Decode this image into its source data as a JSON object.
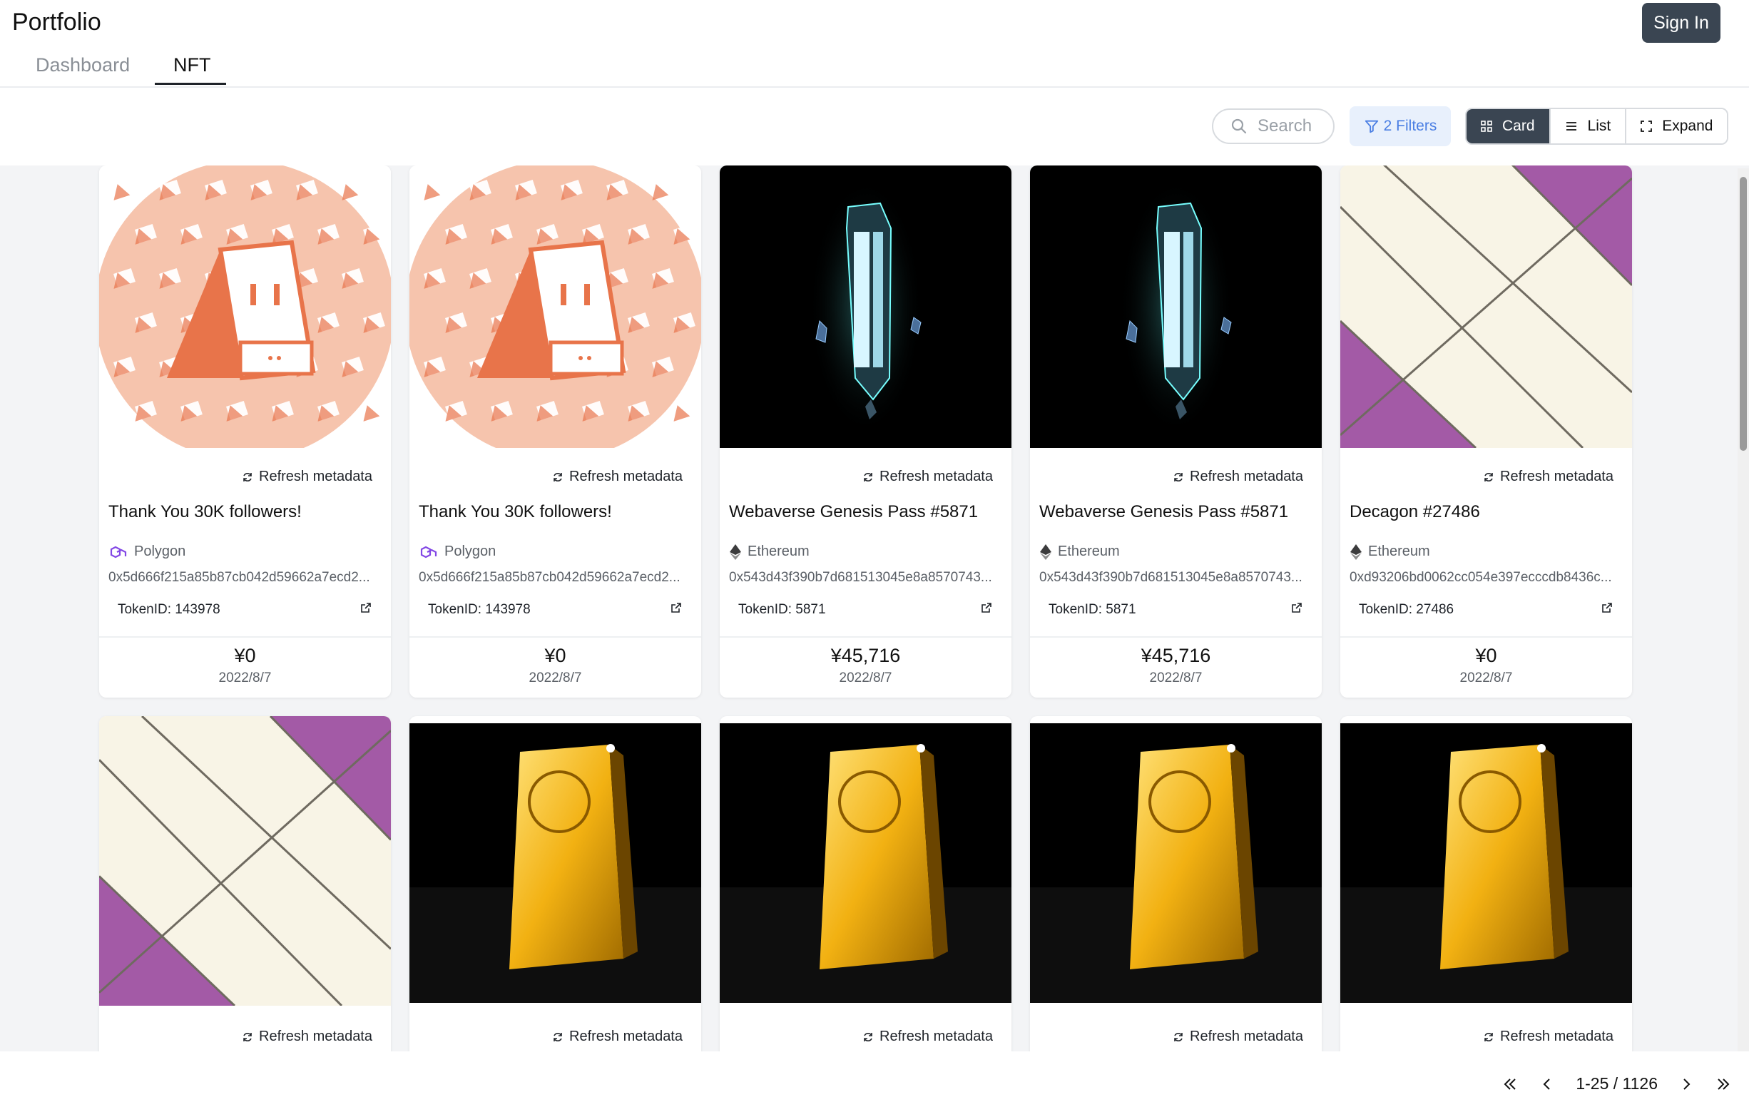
{
  "header": {
    "title": "Portfolio",
    "signin_label": "Sign In",
    "tabs": [
      "Dashboard",
      "NFT"
    ],
    "active_tab": "NFT"
  },
  "toolbar": {
    "search_placeholder": "Search",
    "filters_label": "2 Filters",
    "views": [
      "Card",
      "List",
      "Expand"
    ],
    "active_view": "Card"
  },
  "cards": [
    {
      "refresh": "Refresh metadata",
      "name": "Thank You 30K followers!",
      "chain": "Polygon",
      "address": "0x5d666f215a85b87cb042d59662a7ecd2...",
      "token": "TokenID: 143978",
      "price": "¥0",
      "date": "2022/8/7",
      "image": "kudasai"
    },
    {
      "refresh": "Refresh metadata",
      "name": "Thank You 30K followers!",
      "chain": "Polygon",
      "address": "0x5d666f215a85b87cb042d59662a7ecd2...",
      "token": "TokenID: 143978",
      "price": "¥0",
      "date": "2022/8/7",
      "image": "kudasai"
    },
    {
      "refresh": "Refresh metadata",
      "name": "Webaverse Genesis Pass #5871",
      "chain": "Ethereum",
      "address": "0x543d43f390b7d681513045e8a8570743...",
      "token": "TokenID: 5871",
      "price": "¥45,716",
      "date": "2022/8/7",
      "image": "crystal"
    },
    {
      "refresh": "Refresh metadata",
      "name": "Webaverse Genesis Pass #5871",
      "chain": "Ethereum",
      "address": "0x543d43f390b7d681513045e8a8570743...",
      "token": "TokenID: 5871",
      "price": "¥45,716",
      "date": "2022/8/7",
      "image": "crystal"
    },
    {
      "refresh": "Refresh metadata",
      "name": "Decagon #27486",
      "chain": "Ethereum",
      "address": "0xd93206bd0062cc054e397ecccdb8436c...",
      "token": "TokenID: 27486",
      "price": "¥0",
      "date": "2022/8/7",
      "image": "decagon"
    }
  ],
  "row2": [
    {
      "refresh": "Refresh metadata",
      "image": "decagon"
    },
    {
      "refresh": "Refresh metadata",
      "image": "gold"
    },
    {
      "refresh": "Refresh metadata",
      "image": "gold"
    },
    {
      "refresh": "Refresh metadata",
      "image": "gold"
    },
    {
      "refresh": "Refresh metadata",
      "image": "gold"
    }
  ],
  "pager": {
    "range": "1-25 / 1126"
  },
  "colors": {
    "primary_dark": "#3a4552",
    "filter_blue": "#4a7ee3",
    "polygon_purple": "#8247e5",
    "kudasai_orange": "#e8744a",
    "decagon_purple": "#a35aa6"
  }
}
